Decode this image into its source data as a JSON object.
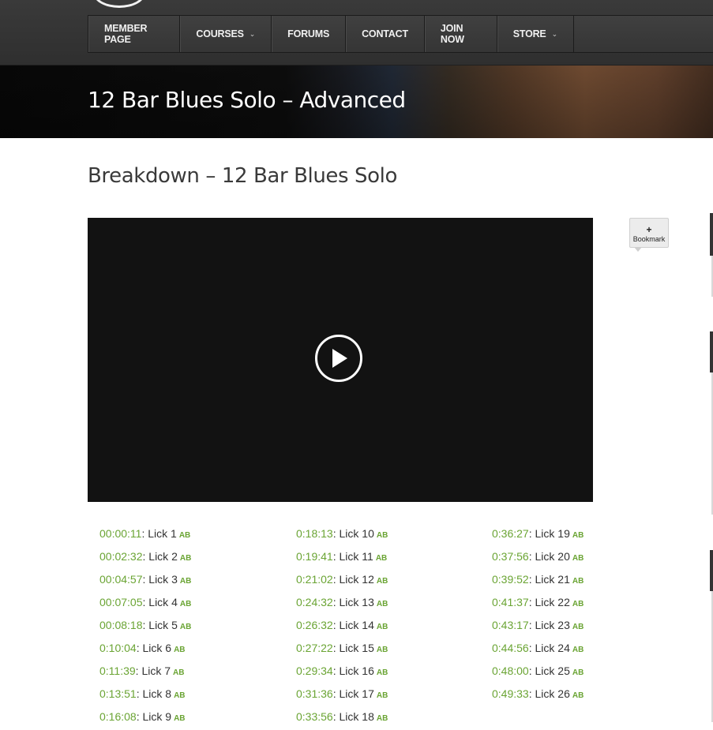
{
  "nav": {
    "items": [
      {
        "label": "MEMBER PAGE",
        "dropdown": false
      },
      {
        "label": "COURSES",
        "dropdown": true
      },
      {
        "label": "FORUMS",
        "dropdown": false
      },
      {
        "label": "CONTACT",
        "dropdown": false
      },
      {
        "label": "JOIN NOW",
        "dropdown": false
      },
      {
        "label": "STORE",
        "dropdown": true
      }
    ]
  },
  "banner": {
    "title": "12 Bar Blues Solo – Advanced"
  },
  "lesson": {
    "title": "Breakdown – 12 Bar Blues Solo"
  },
  "bookmark": {
    "plus": "+",
    "label": "Bookmark"
  },
  "chapters": [
    [
      {
        "time": "00:00:11",
        "label": "Lick 1",
        "ab": "AB"
      },
      {
        "time": "00:02:32",
        "label": "Lick 2",
        "ab": "AB"
      },
      {
        "time": "00:04:57",
        "label": "Lick 3",
        "ab": "AB"
      },
      {
        "time": "00:07:05",
        "label": "Lick 4",
        "ab": "AB"
      },
      {
        "time": "00:08:18",
        "label": "Lick 5",
        "ab": "AB"
      },
      {
        "time": "0:10:04",
        "label": "Lick 6",
        "ab": "AB"
      },
      {
        "time": "0:11:39",
        "label": "Lick 7",
        "ab": "AB"
      },
      {
        "time": "0:13:51",
        "label": "Lick 8",
        "ab": "AB"
      },
      {
        "time": "0:16:08",
        "label": "Lick 9",
        "ab": "AB"
      }
    ],
    [
      {
        "time": "0:18:13",
        "label": "Lick 10",
        "ab": "AB"
      },
      {
        "time": "0:19:41",
        "label": "Lick 11",
        "ab": "AB"
      },
      {
        "time": "0:21:02",
        "label": "Lick 12",
        "ab": "AB"
      },
      {
        "time": "0:24:32",
        "label": "Lick 13",
        "ab": "AB"
      },
      {
        "time": "0:26:32",
        "label": "Lick 14",
        "ab": "AB"
      },
      {
        "time": "0:27:22",
        "label": "Lick 15",
        "ab": "AB"
      },
      {
        "time": "0:29:34",
        "label": "Lick 16",
        "ab": "AB"
      },
      {
        "time": "0:31:36",
        "label": "Lick 17",
        "ab": "AB"
      },
      {
        "time": "0:33:56",
        "label": "Lick 18",
        "ab": "AB"
      }
    ],
    [
      {
        "time": "0:36:27",
        "label": "Lick 19",
        "ab": "AB"
      },
      {
        "time": "0:37:56",
        "label": "Lick 20",
        "ab": "AB"
      },
      {
        "time": "0:39:52",
        "label": "Lick 21",
        "ab": "AB"
      },
      {
        "time": "0:41:37",
        "label": "Lick 22",
        "ab": "AB"
      },
      {
        "time": "0:43:17",
        "label": "Lick 23",
        "ab": "AB"
      },
      {
        "time": "0:44:56",
        "label": "Lick 24",
        "ab": "AB"
      },
      {
        "time": "0:48:00",
        "label": "Lick 25",
        "ab": "AB"
      },
      {
        "time": "0:49:33",
        "label": "Lick 26",
        "ab": "AB"
      }
    ]
  ]
}
